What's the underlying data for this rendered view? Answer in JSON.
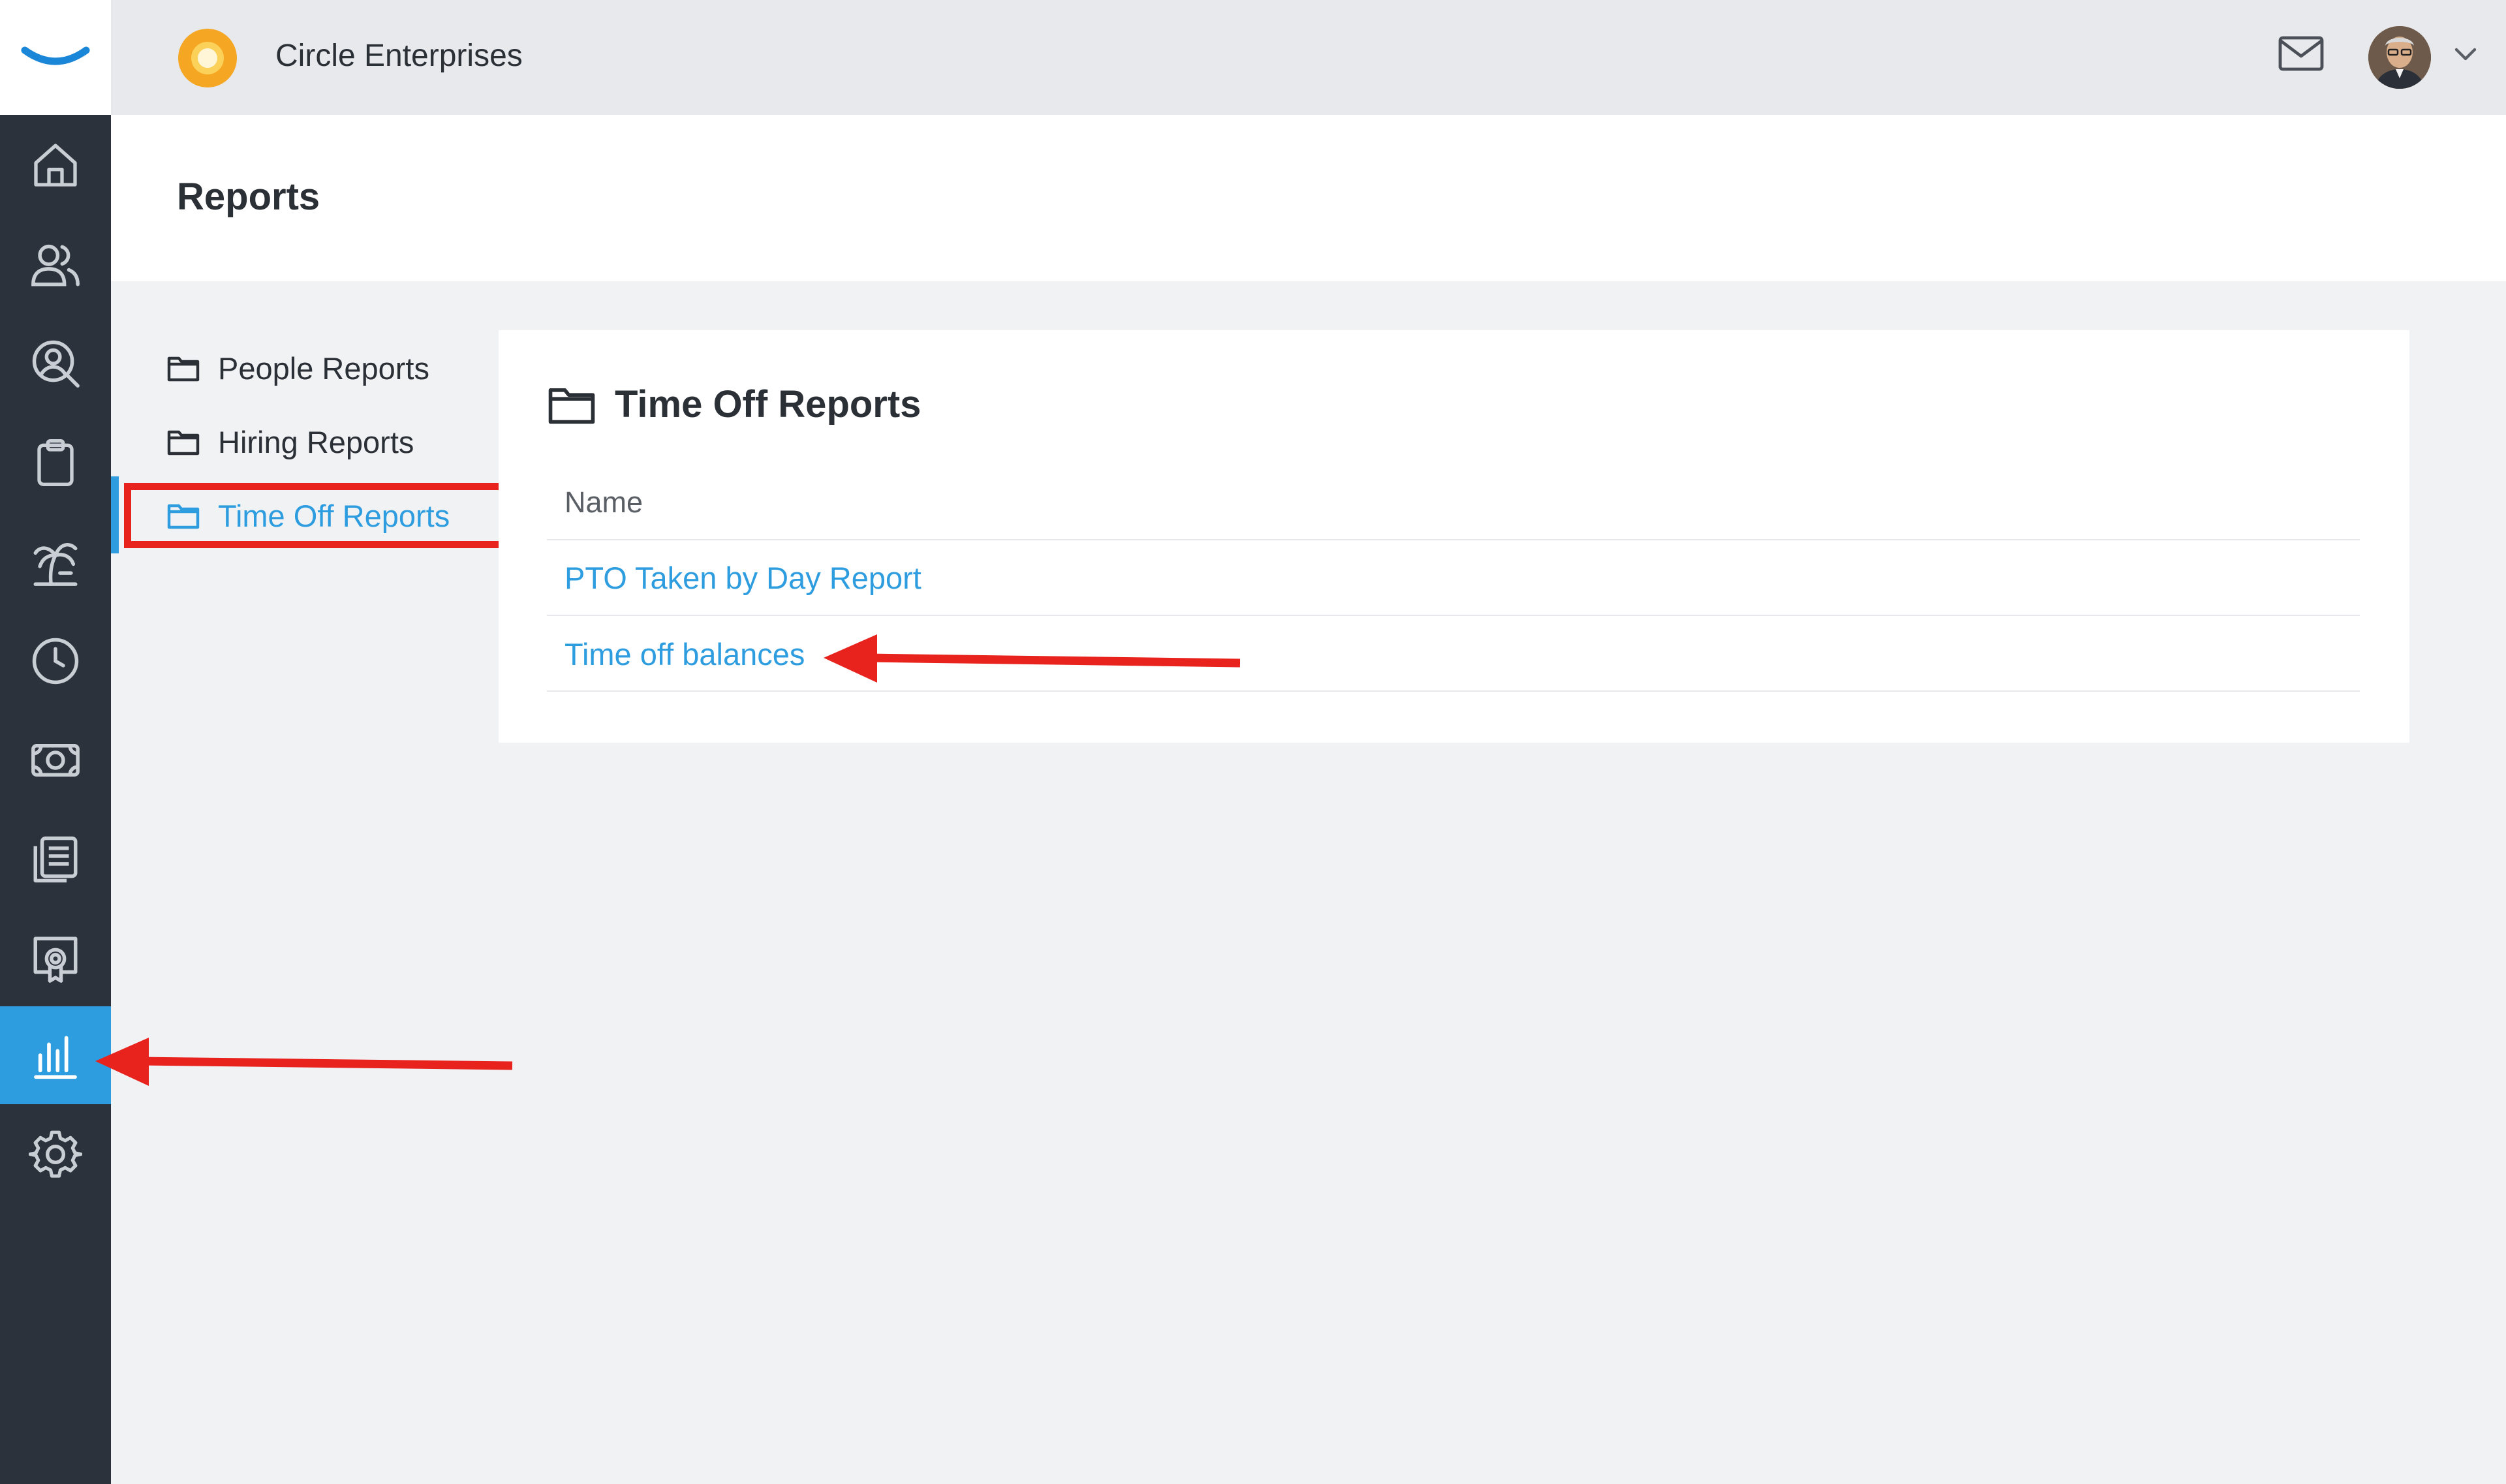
{
  "header": {
    "company_name": "Circle Enterprises",
    "icons": [
      "brand-smile-logo",
      "company-logo-circle",
      "mail-icon",
      "user-avatar",
      "chevron-down-icon"
    ]
  },
  "nav": {
    "items": [
      {
        "icon": "home-icon"
      },
      {
        "icon": "people-icon"
      },
      {
        "icon": "search-person-icon"
      },
      {
        "icon": "clipboard-icon"
      },
      {
        "icon": "palm-tree-icon"
      },
      {
        "icon": "clock-icon"
      },
      {
        "icon": "money-icon"
      },
      {
        "icon": "documents-icon"
      },
      {
        "icon": "certificate-icon"
      },
      {
        "icon": "bar-chart-icon",
        "active": true
      },
      {
        "icon": "gear-icon"
      }
    ]
  },
  "page": {
    "title": "Reports"
  },
  "folders": [
    {
      "label": "People Reports"
    },
    {
      "label": "Hiring Reports"
    },
    {
      "label": "Time Off Reports",
      "active": true
    }
  ],
  "panel": {
    "title": "Time Off Reports",
    "column_header": "Name",
    "reports": [
      {
        "label": "PTO Taken by Day Report"
      },
      {
        "label": "Time off balances"
      }
    ]
  },
  "colors": {
    "accent": "#2d9de0",
    "rail": "#2b323b",
    "annotation": "#e8231d",
    "company_logo": "#f5a623"
  }
}
